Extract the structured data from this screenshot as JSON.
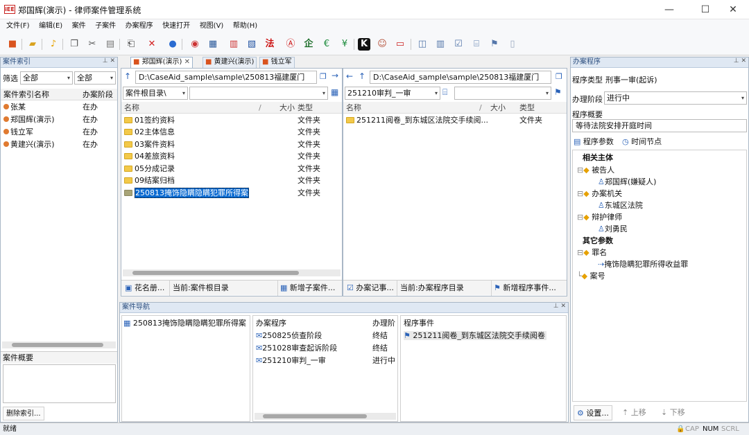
{
  "window": {
    "logo": "iEE",
    "title": "郑国辉(演示) - 律师案件管理系统",
    "min": "—",
    "max": "☐",
    "close": "✕"
  },
  "menu": [
    "文件(F)",
    "编辑(E)",
    "案件",
    "子案件",
    "办案程序",
    "快速打开",
    "视图(V)",
    "帮助(H)"
  ],
  "toolbar_icons": [
    "case-icon",
    "folder-open-icon",
    "bell-icon",
    "copy-icon",
    "cut-icon",
    "paste-icon",
    "export-icon",
    "delete-icon",
    "help-icon",
    "emblem-icon",
    "building-icon",
    "calendar-icon",
    "document-icon",
    "law-icon",
    "seal-icon",
    "company-icon",
    "money-icon",
    "currency-icon",
    "k-icon",
    "avatar-icon",
    "card-icon",
    "phonebook-icon",
    "archive-icon",
    "edit-icon",
    "scan-icon",
    "flag-icon",
    "file-icon"
  ],
  "case_index": {
    "title": "案件索引",
    "filter_label": "筛选",
    "filter_value": "全部",
    "filter2_value": "全部",
    "col_name": "案件索引名称",
    "col_stage": "办案阶段",
    "rows": [
      {
        "name": "张某",
        "stage": "在办"
      },
      {
        "name": "郑国辉(演示)",
        "stage": "在办"
      },
      {
        "name": "钱立军",
        "stage": "在办"
      },
      {
        "name": "黄建兴(演示)",
        "stage": "在办"
      }
    ],
    "overview_label": "案件概要",
    "delete_button": "删除索引..."
  },
  "tabs": [
    "郑国辉(演示)",
    "黄建兴(演示)",
    "钱立军"
  ],
  "left_browser": {
    "path": "D:\\CaseAid_sample\\sample\\250813福建厦门",
    "root_combo": "案件根目录\\",
    "col_name": "名称",
    "col_size": "大小",
    "col_type": "类型",
    "items": [
      {
        "name": "01签约资料",
        "type": "文件夹"
      },
      {
        "name": "02主体信息",
        "type": "文件夹"
      },
      {
        "name": "03案件资料",
        "type": "文件夹"
      },
      {
        "name": "04差旅资料",
        "type": "文件夹"
      },
      {
        "name": "05分成记录",
        "type": "文件夹"
      },
      {
        "name": "09结案归档",
        "type": "文件夹"
      },
      {
        "name": "250813掩饰隐瞒隐瞒犯罪所得案",
        "type": "文件夹"
      }
    ],
    "btn_roster": "花名册...",
    "current": "当前:案件根目录",
    "btn_new_sub": "新增子案件..."
  },
  "right_browser": {
    "path": "D:\\CaseAid_sample\\sample\\250813福建厦门",
    "combo": "251210审判_一审",
    "col_name": "名称",
    "col_size": "大小",
    "col_type": "类型",
    "items": [
      {
        "name": "251211阅卷_到东城区法院交手续阅...",
        "type": "文件夹"
      }
    ],
    "btn_record": "办案记事...",
    "current": "当前:办案程序目录",
    "btn_new_event": "新增程序事件..."
  },
  "case_nav": {
    "title": "案件导航",
    "case_item": "250813掩饰隐瞒隐瞒犯罪所得案",
    "col_procedure": "办案程序",
    "col_stage": "办理阶",
    "procedures": [
      {
        "name": "250825侦查阶段",
        "stage": "终结"
      },
      {
        "name": "251028审查起诉阶段",
        "stage": "终结"
      },
      {
        "name": "251210审判_一审",
        "stage": "进行中"
      }
    ],
    "col_event": "程序事件",
    "events": [
      "251211阅卷_到东城区法院交手续阅卷"
    ]
  },
  "procedure_panel": {
    "title": "办案程序",
    "type_label": "程序类型",
    "type_value": "刑事一审(起诉)",
    "stage_label": "办理阶段",
    "stage_value": "进行中",
    "summary_label": "程序概要",
    "summary_value": "等待法院安排开庭时间",
    "tab_params": "程序参数",
    "tab_timeline": "时间节点",
    "tree": {
      "related": "相关主体",
      "defendant": "被告人",
      "defendant_name": "郑国辉(嫌疑人)",
      "agency": "办案机关",
      "agency_name": "东城区法院",
      "lawyer": "辩护律师",
      "lawyer_name": "刘勇民",
      "other": "其它参数",
      "charge": "罪名",
      "charge_name": "掩饰隐瞒犯罪所得收益罪",
      "case_no": "案号"
    },
    "btn_settings": "设置...",
    "btn_up": "上移",
    "btn_down": "下移"
  },
  "status": {
    "left": "就绪",
    "caps": "CAP",
    "num": "NUM",
    "scrl": "SCRL"
  }
}
